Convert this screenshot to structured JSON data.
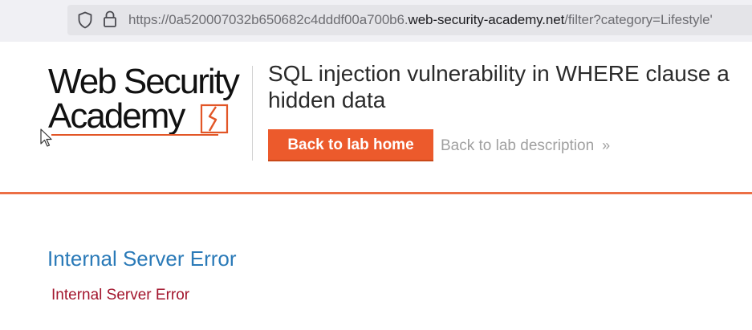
{
  "browser": {
    "url_prefix": "https://0a520007032b650682c4dddf00a700b6.",
    "url_domain": "web-security-academy.net",
    "url_path": "/filter?category=Lifestyle'",
    "icons": [
      "shield-icon",
      "lock-icon"
    ]
  },
  "header": {
    "logo_line1": "Web Security",
    "logo_line2": "Academy",
    "lab_title_line1": "SQL injection vulnerability in WHERE clause a",
    "lab_title_line2": "hidden data",
    "home_button": "Back to lab home",
    "description_link": "Back to lab description",
    "description_icon": "double-chevron-right-icon"
  },
  "content": {
    "error_heading": "Internal Server Error",
    "error_detail": "Internal Server Error"
  },
  "colors": {
    "accent": "#ec5a2c",
    "heading_blue": "#2a7ab8",
    "error_red": "#a3162e",
    "rule": "#ec6f45"
  }
}
